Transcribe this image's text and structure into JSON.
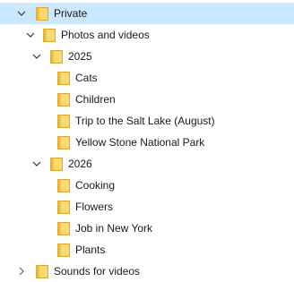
{
  "tree": {
    "items": [
      {
        "label": "Private",
        "state": "expanded",
        "selected": true
      },
      {
        "label": "Photos and videos",
        "state": "expanded"
      },
      {
        "label": "2025",
        "state": "expanded"
      },
      {
        "label": "Cats"
      },
      {
        "label": "Children"
      },
      {
        "label": "Trip to the Salt Lake (August)"
      },
      {
        "label": "Yellow Stone National Park"
      },
      {
        "label": "2026",
        "state": "expanded"
      },
      {
        "label": "Cooking"
      },
      {
        "label": "Flowers"
      },
      {
        "label": "Job in New York"
      },
      {
        "label": "Plants"
      },
      {
        "label": "Sounds for videos",
        "state": "collapsed"
      }
    ]
  },
  "colors": {
    "selection": "#cce8ff",
    "folder_body": "#f8d775",
    "folder_tab": "#e8b949",
    "chevron": "#333333"
  },
  "icons": {
    "folder": "folder-icon",
    "expanded": "chevron-down-icon",
    "collapsed": "chevron-right-icon"
  }
}
